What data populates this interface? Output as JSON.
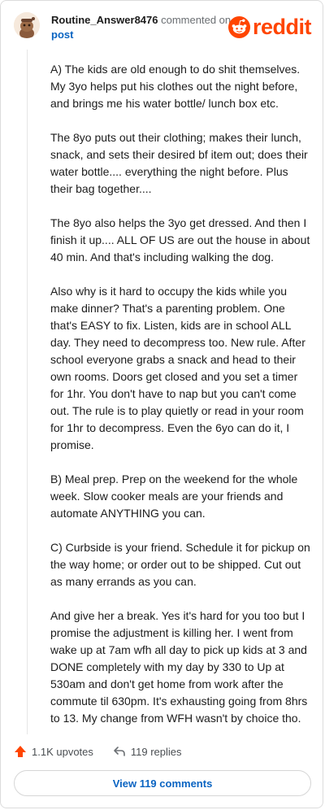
{
  "header": {
    "username": "Routine_Answer8476",
    "action_text": "commented on",
    "post_link": "post",
    "brand": "reddit"
  },
  "icons": {
    "avatar": "snoo-avatar-icon",
    "brand_logo": "reddit-snoo-icon",
    "upvote": "upvote-arrow-icon",
    "reply": "reply-arrow-icon"
  },
  "colors": {
    "brand": "#ff4500",
    "link": "#0a64c2",
    "text": "#1c1c1c",
    "muted": "#6b6f73"
  },
  "comment": {
    "paragraphs": [
      "A) The kids are old enough to do shit themselves. My 3yo helps put his clothes out the night before, and brings me his water bottle/ lunch box etc.",
      "The 8yo puts out their clothing; makes their lunch, snack, and sets their desired bf item out; does their water bottle.... everything the night before. Plus their bag together....",
      "The 8yo also helps the 3yo get dressed. And then I finish it up.... ALL OF US are out the house in about 40 min. And that's including walking the dog.",
      "Also why is it hard to occupy the kids while you make dinner? That's a parenting problem. One that's EASY to fix. Listen, kids are in school ALL day. They need to decompress too. New rule. After school everyone grabs a snack and head to their own rooms. Doors get closed and you set a timer for 1hr. You don't have to nap but you can't come out. The rule is to play quietly or read in your room for 1hr to decompress. Even the 6yo can do it, I promise.",
      "B) Meal prep. Prep on the weekend for the whole week. Slow cooker meals are your friends and automate ANYTHING you can.",
      "C) Curbside is your friend. Schedule it for pickup on the way home; or order out to be shipped. Cut out as many errands as you can.",
      "And give her a break. Yes it's hard for you too but I promise the adjustment is killing her. I went from wake up at 7am wfh all day to pick up kids at 3 and DONE completely with my day by 330 to Up at 530am and don't get home from work after the commute til 630pm. It's exhausting going from 8hrs to 13. My change from WFH wasn't by choice tho."
    ]
  },
  "actions": {
    "upvotes": "1.1K upvotes",
    "replies": "119 replies"
  },
  "footer": {
    "view_comments": "View 119 comments"
  }
}
